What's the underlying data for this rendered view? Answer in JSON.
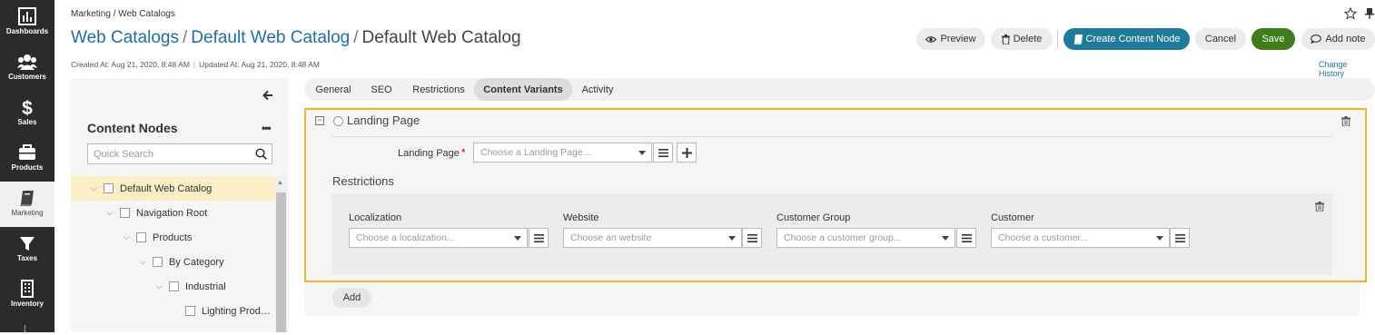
{
  "sidebar": {
    "items": [
      {
        "label": "Dashboards",
        "icon": "bar-chart-icon"
      },
      {
        "label": "Customers",
        "icon": "users-icon"
      },
      {
        "label": "Sales",
        "icon": "dollar-icon"
      },
      {
        "label": "Products",
        "icon": "briefcase-icon"
      },
      {
        "label": "Marketing",
        "icon": "book-icon"
      },
      {
        "label": "Taxes",
        "icon": "funnel-icon"
      },
      {
        "label": "Inventory",
        "icon": "building-icon"
      }
    ]
  },
  "header": {
    "breadcrumb": "Marketing / Web Catalogs",
    "title_link1": "Web Catalogs",
    "title_sep": "/",
    "title_link2": "Default Web Catalog",
    "title_current": "Default Web Catalog",
    "created": "Created At: Aug 21, 2020, 8:48 AM",
    "updated": "Updated At: Aug 21, 2020, 8:48 AM",
    "change_history": "Change History"
  },
  "toolbar": {
    "preview": "Preview",
    "delete": "Delete",
    "create_content_node": "Create Content Node",
    "cancel": "Cancel",
    "save": "Save",
    "add_note": "Add note"
  },
  "tree": {
    "title": "Content Nodes",
    "more": "•••",
    "search_placeholder": "Quick Search",
    "nodes": [
      {
        "label": "Default Web Catalog",
        "selected": true
      },
      {
        "label": "Navigation Root"
      },
      {
        "label": "Products"
      },
      {
        "label": "By Category"
      },
      {
        "label": "Industrial"
      },
      {
        "label": "Lighting Prod…"
      }
    ]
  },
  "tabs": [
    "General",
    "SEO",
    "Restrictions",
    "Content Variants",
    "Activity"
  ],
  "active_tab": "Content Variants",
  "variant": {
    "title": "Landing Page",
    "landing_page_label": "Landing Page",
    "required_mark": "*",
    "landing_page_placeholder": "Choose a Landing Page...",
    "restrictions_title": "Restrictions",
    "restrictions": [
      {
        "label": "Localization",
        "placeholder": "Choose a localization..."
      },
      {
        "label": "Website",
        "placeholder": "Choose an website"
      },
      {
        "label": "Customer Group",
        "placeholder": "Choose a customer group..."
      },
      {
        "label": "Customer",
        "placeholder": "Choose a customer..."
      }
    ],
    "add_label": "Add"
  },
  "colors": {
    "sidebar_bg": "#2b2b2b",
    "link": "#1f6ea3",
    "primary_button": "#1f7c98",
    "save_button": "#3d7d1a",
    "variant_border": "#f0b428",
    "selected_row": "#fbefc6"
  }
}
